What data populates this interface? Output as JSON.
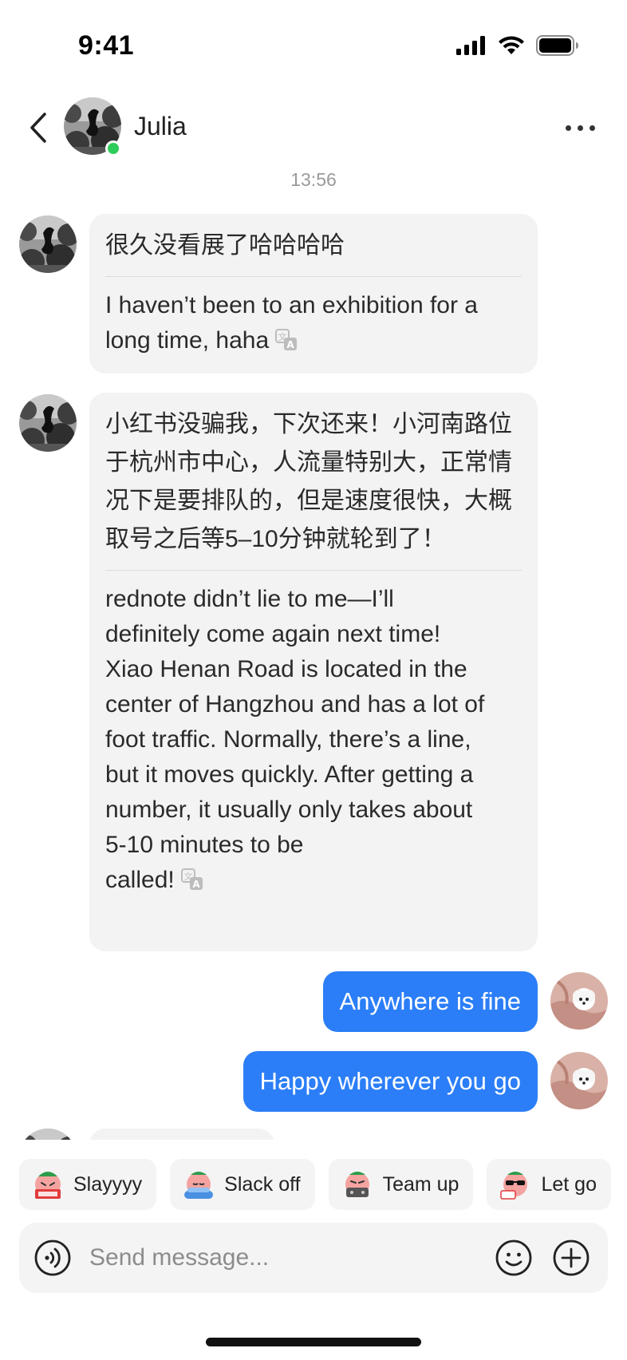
{
  "status_bar": {
    "time": "9:41",
    "icons": [
      "cellular-signal-icon",
      "wifi-icon",
      "battery-icon"
    ]
  },
  "header": {
    "back_icon": "chevron-left-icon",
    "contact_name": "Julia",
    "online": true,
    "online_color": "#2ecc5b",
    "more_icon": "more-horizontal-icon"
  },
  "timestamp": "13:56",
  "messages": [
    {
      "direction": "incoming",
      "original": "很久没看展了哈哈哈哈",
      "translation": "I haven’t been to an exhibition for a long time, haha",
      "translate_icon": "translate-icon"
    },
    {
      "direction": "incoming",
      "original": "小红书没骗我，下次还来！小河南路位于杭州市中心，人流量特别大，正常情况下是要排队的，但是速度很快，大概取号之后等5–10分钟就轮到了！",
      "translation_lines": [
        "rednote didn’t lie to me—I’ll",
        "definitely come again next time!",
        "Xiao Henan Road is located in the",
        "center of Hangzhou and has a lot of",
        "foot traffic. Normally, there’s a line,",
        "but it moves quickly. After getting a",
        "number, it usually only takes about",
        "5-10 minutes to be",
        "called!"
      ],
      "translate_icon": "translate-icon"
    },
    {
      "direction": "outgoing",
      "text": "Anywhere is fine"
    },
    {
      "direction": "outgoing",
      "text": "Happy wherever you go"
    }
  ],
  "quick_replies": [
    {
      "label": "Slayyyy",
      "sticker": "slay-sticker-icon"
    },
    {
      "label": "Slack off",
      "sticker": "slack-off-sticker-icon"
    },
    {
      "label": "Team up",
      "sticker": "team-up-sticker-icon"
    },
    {
      "label": "Let go",
      "sticker": "let-go-sticker-icon"
    }
  ],
  "composer": {
    "placeholder": "Send message...",
    "value": "",
    "voice_icon": "voice-icon",
    "emoji_icon": "emoji-icon",
    "plus_icon": "plus-icon"
  },
  "colors": {
    "outgoing_bubble": "#2b7ef7",
    "incoming_bubble": "#f3f3f3",
    "timestamp": "#9a9a9a"
  }
}
